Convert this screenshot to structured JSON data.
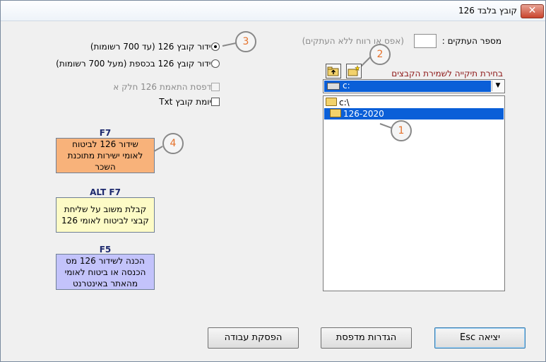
{
  "window": {
    "title": "קובץ בלבד 126",
    "close_glyph": "✕"
  },
  "employees": {
    "label": "מספר העתקים :",
    "hint": "(אפס או רווח ללא העתקים)",
    "value": ""
  },
  "options": {
    "radio_up_to_700": "שידור קובץ 126 (עד 700 רשומות)",
    "radio_over_700": "שידור קובץ 126 בכספת (מעל 700 רשומות)",
    "check_print_part_a": "הדפסת התאמת 126 חלק א",
    "check_txt": "סיומת קובץ Txt"
  },
  "folder": {
    "label": "בחירת תיקייה לשמירת הקבצים",
    "drive": "c:",
    "items": [
      "c:\\",
      "126-2020"
    ]
  },
  "actions": [
    {
      "key": "F7",
      "text": "שידור 126 לביטוח לאומי ישירות מתוכנת השכר",
      "color": "#f8b27a"
    },
    {
      "key": "ALT F7",
      "text": "קבלת משוב על שליחת קבצי לביטוח לאומי 126",
      "color": "#fdfbc6"
    },
    {
      "key": "F5",
      "text": "הכנה לשידור 126 מס הכנסה או ביטוח לאומי מהאתר באינטרנט",
      "color": "#c3c3fb"
    }
  ],
  "callouts": [
    "1",
    "2",
    "3",
    "4"
  ],
  "buttons": {
    "exit": "יציאה Esc",
    "printer_settings": "הגדרות מדפסת",
    "stop_work": "הפסקת עבודה"
  },
  "icons": {
    "up_folder": "folder-up-icon",
    "new_folder": "new-folder-icon"
  }
}
